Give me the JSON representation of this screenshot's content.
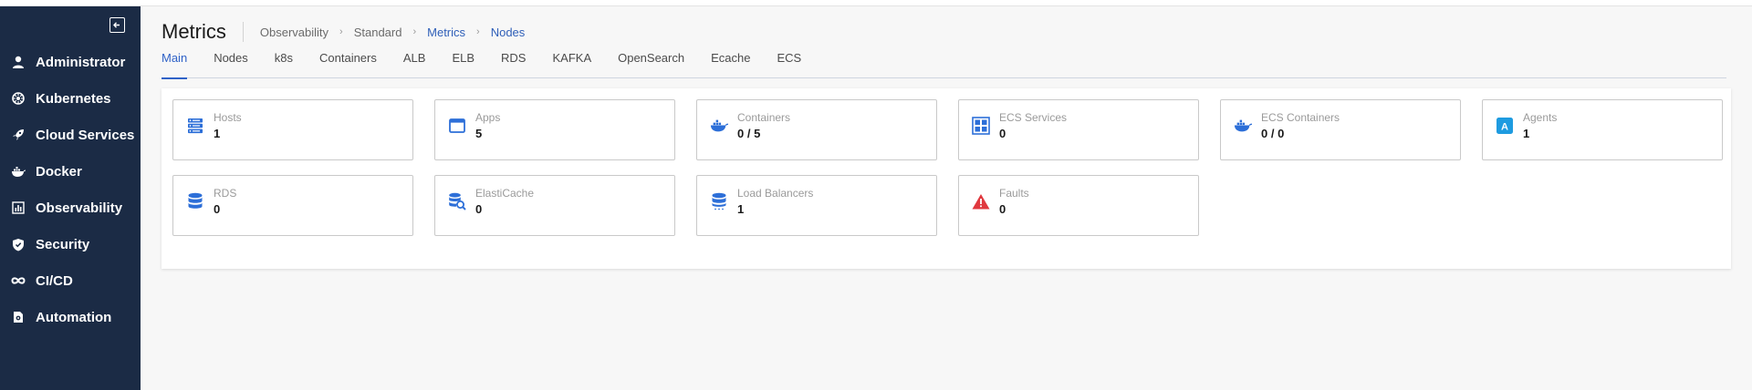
{
  "sidebar": {
    "collapse_icon": "collapse-left-icon",
    "items": [
      {
        "label": "Administrator",
        "icon": "user-icon"
      },
      {
        "label": "Kubernetes",
        "icon": "kubernetes-icon"
      },
      {
        "label": "Cloud Services",
        "icon": "rocket-icon"
      },
      {
        "label": "Docker",
        "icon": "docker-icon"
      },
      {
        "label": "Observability",
        "icon": "chart-icon"
      },
      {
        "label": "Security",
        "icon": "shield-icon"
      },
      {
        "label": "CI/CD",
        "icon": "infinity-icon"
      },
      {
        "label": "Automation",
        "icon": "automation-icon"
      }
    ]
  },
  "header": {
    "title": "Metrics",
    "breadcrumb": [
      "Observability",
      "Standard",
      "Metrics",
      "Nodes"
    ]
  },
  "tabs": [
    "Main",
    "Nodes",
    "k8s",
    "Containers",
    "ALB",
    "ELB",
    "RDS",
    "KAFKA",
    "OpenSearch",
    "Ecache",
    "ECS"
  ],
  "active_tab": "Main",
  "cards": [
    {
      "label": "Hosts",
      "value": "1",
      "icon": "server-icon"
    },
    {
      "label": "Apps",
      "value": "5",
      "icon": "window-icon"
    },
    {
      "label": "Containers",
      "value": "0 / 5",
      "icon": "docker-icon"
    },
    {
      "label": "ECS Services",
      "value": "0",
      "icon": "grid-icon"
    },
    {
      "label": "ECS Containers",
      "value": "0 / 0",
      "icon": "docker-icon"
    },
    {
      "label": "Agents",
      "value": "1",
      "icon": "agent-badge-icon"
    },
    {
      "label": "RDS",
      "value": "0",
      "icon": "database-icon"
    },
    {
      "label": "ElastiCache",
      "value": "0",
      "icon": "database-search-icon"
    },
    {
      "label": "Load Balancers",
      "value": "1",
      "icon": "database-icon"
    },
    {
      "label": "Faults",
      "value": "0",
      "icon": "warning-icon"
    }
  ],
  "colors": {
    "sidebar_bg": "#1b2b45",
    "accent": "#2f62c7",
    "icon_blue": "#2d6fd8",
    "fault_red": "#e0383e"
  }
}
